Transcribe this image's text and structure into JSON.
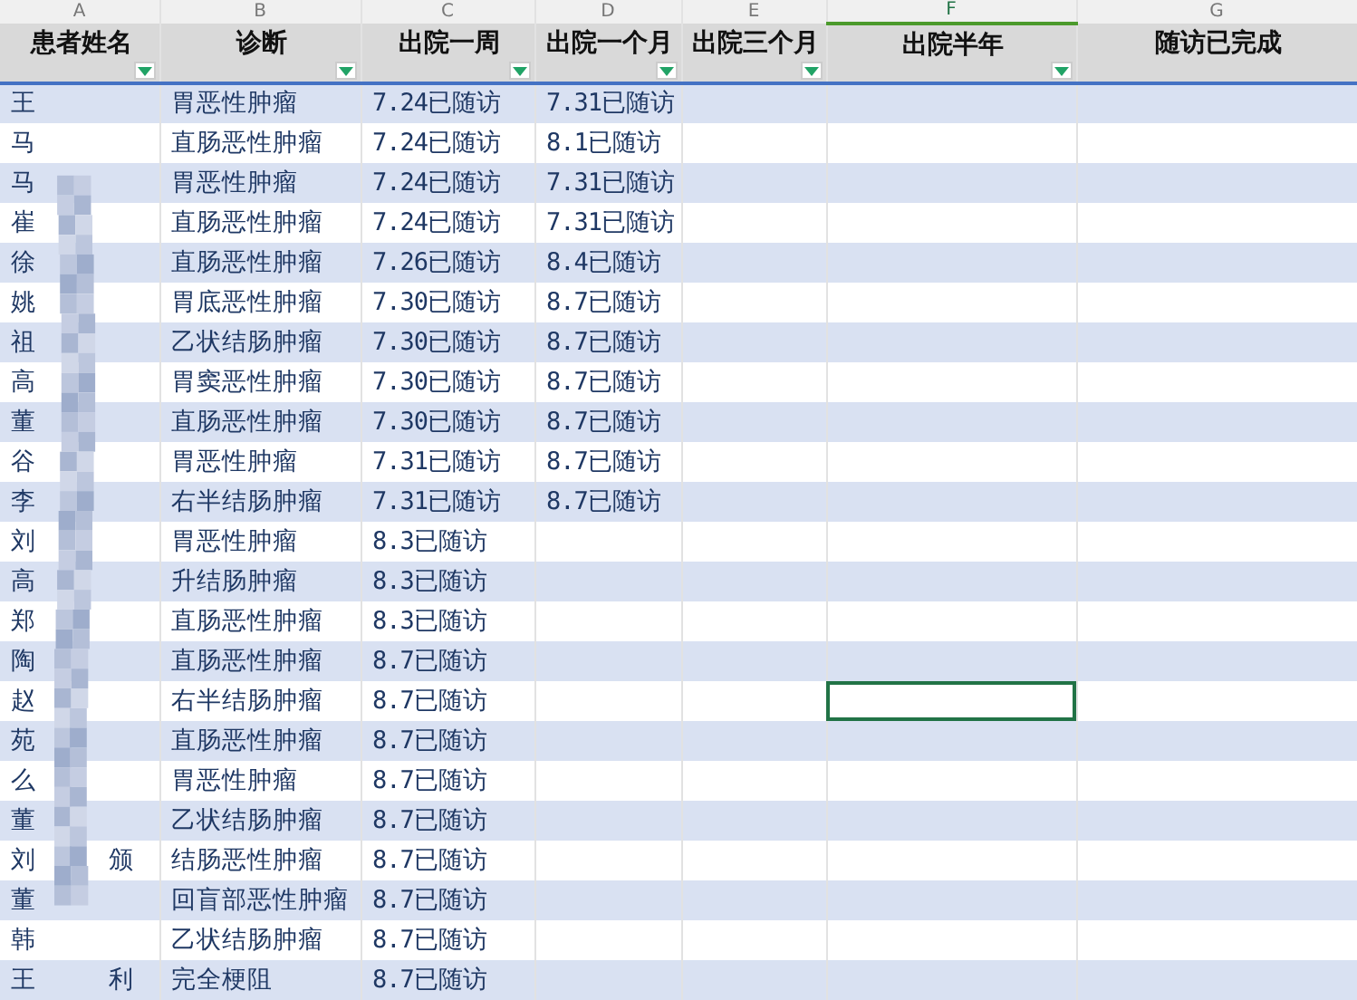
{
  "columns": [
    {
      "letter": "A",
      "title": "患者姓名",
      "filter": true,
      "selected": false
    },
    {
      "letter": "B",
      "title": "诊断",
      "filter": true,
      "selected": false
    },
    {
      "letter": "C",
      "title": "出院一周",
      "filter": true,
      "selected": false
    },
    {
      "letter": "D",
      "title": "出院一个月",
      "filter": true,
      "selected": false
    },
    {
      "letter": "E",
      "title": "出院三个月",
      "filter": true,
      "selected": false
    },
    {
      "letter": "F",
      "title": "出院半年",
      "filter": true,
      "selected": true
    },
    {
      "letter": "G",
      "title": "随访已完成",
      "filter": false,
      "selected": false
    }
  ],
  "rows": [
    {
      "name": "王",
      "diagnosis": "胃恶性肿瘤",
      "week": "7.24已随访",
      "month": "7.31已随访",
      "selected": false
    },
    {
      "name": "马",
      "diagnosis": "直肠恶性肿瘤",
      "week": "7.24已随访",
      "month": "8.1已随访",
      "selected": false
    },
    {
      "name": "马",
      "diagnosis": "胃恶性肿瘤",
      "week": "7.24已随访",
      "month": "7.31已随访",
      "selected": false
    },
    {
      "name": "崔",
      "diagnosis": "直肠恶性肿瘤",
      "week": "7.24已随访",
      "month": "7.31已随访",
      "selected": false
    },
    {
      "name": "徐",
      "diagnosis": "直肠恶性肿瘤",
      "week": "7.26已随访",
      "month": "8.4已随访",
      "selected": false
    },
    {
      "name": "姚",
      "diagnosis": "胃底恶性肿瘤",
      "week": "7.30已随访",
      "month": "8.7已随访",
      "selected": false
    },
    {
      "name": "祖",
      "diagnosis": "乙状结肠肿瘤",
      "week": "7.30已随访",
      "month": "8.7已随访",
      "selected": false
    },
    {
      "name": "高",
      "diagnosis": "胃窦恶性肿瘤",
      "week": "7.30已随访",
      "month": "8.7已随访",
      "selected": false
    },
    {
      "name": "董",
      "diagnosis": "直肠恶性肿瘤",
      "week": "7.30已随访",
      "month": "8.7已随访",
      "selected": false
    },
    {
      "name": "谷",
      "diagnosis": "胃恶性肿瘤",
      "week": "7.31已随访",
      "month": "8.7已随访",
      "selected": false
    },
    {
      "name": "李",
      "diagnosis": "右半结肠肿瘤",
      "week": "7.31已随访",
      "month": "8.7已随访",
      "selected": false
    },
    {
      "name": "刘",
      "diagnosis": "胃恶性肿瘤",
      "week": "8.3已随访",
      "selected": false
    },
    {
      "name": "高",
      "diagnosis": "升结肠肿瘤",
      "week": "8.3已随访",
      "selected": false
    },
    {
      "name": "郑",
      "diagnosis": "直肠恶性肿瘤",
      "week": "8.3已随访",
      "selected": false
    },
    {
      "name": "陶",
      "diagnosis": "直肠恶性肿瘤",
      "week": "8.7已随访",
      "selected": false
    },
    {
      "name": "赵",
      "diagnosis": "右半结肠肿瘤",
      "week": "8.7已随访",
      "selected": true
    },
    {
      "name": "苑",
      "diagnosis": "直肠恶性肿瘤",
      "week": "8.7已随访",
      "selected": false
    },
    {
      "name": "么",
      "diagnosis": "胃恶性肿瘤",
      "week": "8.7已随访",
      "selected": false
    },
    {
      "name": "董",
      "diagnosis": "乙状结肠肿瘤",
      "week": "8.7已随访",
      "selected": false
    },
    {
      "name": "刘",
      "name_tail": "颁",
      "diagnosis": "结肠恶性肿瘤",
      "week": "8.7已随访",
      "selected": false
    },
    {
      "name": "董",
      "diagnosis": "回盲部恶性肿瘤",
      "week": "8.7已随访",
      "selected": false
    },
    {
      "name": "韩",
      "diagnosis": "乙状结肠肿瘤",
      "week": "8.7已随访",
      "selected": false
    },
    {
      "name": "王",
      "name_tail": "利",
      "diagnosis": "完全梗阻",
      "week": "8.7已随访",
      "selected": false
    }
  ]
}
